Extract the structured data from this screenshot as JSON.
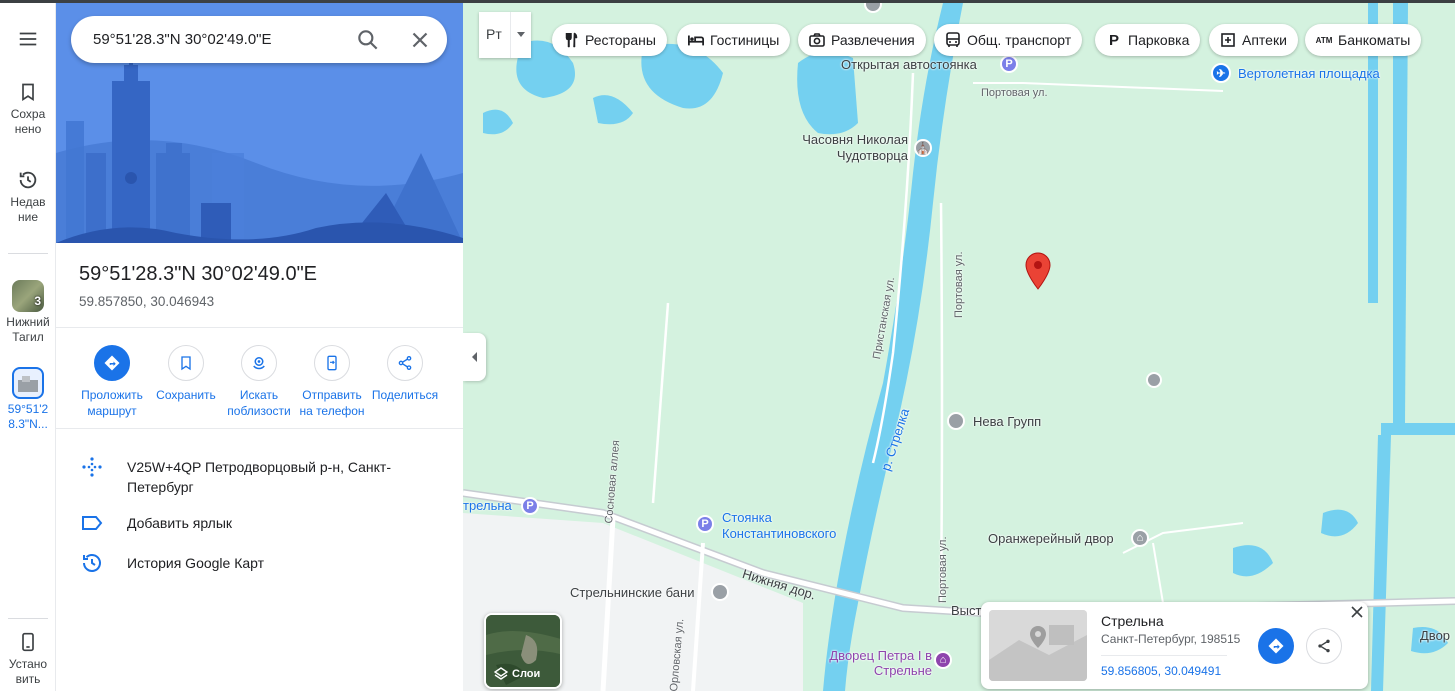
{
  "rail": {
    "menu_icon": "menu-icon",
    "saved_label": "Сохранено",
    "recent_label": "Недавние",
    "recent1": {
      "badge": "3",
      "label": "Нижний Тагил"
    },
    "recent2": {
      "label": "59°51'28.3\"N..."
    },
    "install_label": "Установить"
  },
  "search": {
    "value": "59°51'28.3\"N 30°02'49.0\"E"
  },
  "place": {
    "title": "59°51'28.3\"N 30°02'49.0\"E",
    "coords": "59.857850, 30.046943"
  },
  "actions": [
    {
      "label": "Проложить маршрут",
      "icon": "directions-icon"
    },
    {
      "label": "Сохранить",
      "icon": "bookmark-icon"
    },
    {
      "label": "Искать поблизости",
      "icon": "nearby-icon"
    },
    {
      "label": "Отправить на телефон",
      "icon": "send-to-phone-icon"
    },
    {
      "label": "Поделиться",
      "icon": "share-icon"
    }
  ],
  "info": {
    "plus_code": "V25W+4QP Петродворцовый р-н, Санкт-Петербург",
    "add_label": "Добавить ярлык",
    "history": "История Google Карт"
  },
  "transit_btn": "Рт",
  "chips": [
    {
      "label": "Рестораны",
      "icon": "fork-knife-icon"
    },
    {
      "label": "Гостиницы",
      "icon": "bed-icon"
    },
    {
      "label": "Развлечения",
      "icon": "camera-icon"
    },
    {
      "label": "Общ. транспорт",
      "icon": "bus-icon"
    },
    {
      "label": "Парковка",
      "icon": "parking-icon"
    },
    {
      "label": "Аптеки",
      "icon": "pharmacy-icon"
    },
    {
      "label": "Банкоматы",
      "icon": "atm-icon"
    }
  ],
  "map_labels": {
    "open_parking": "Открытая автостоянка",
    "helipad": "Вертолетная площадка",
    "portovaya_top": "Портовая ул.",
    "chapel": "Часовня Николая Чудотворца",
    "pristanskaya": "Пристанская ул.",
    "portovaya_mid": "Портовая ул.",
    "river": "р. Стрелка",
    "neva": "Нева Групп",
    "strelna_parking": "трельна",
    "konst_parking": "Стоянка Константиновского",
    "sosnovaya": "Сосновая аллея",
    "orangery": "Оранжерейный двор",
    "portovaya_low": "Портовая ул.",
    "nizhnyaya": "Нижняя дор.",
    "bani": "Стрельнинские бани",
    "orlovskaya": "Орловская ул.",
    "palace": "Дворец Петра I в Стрельне",
    "vyst": "Выст",
    "dvor": "Двор"
  },
  "layers_label": "Слои",
  "card": {
    "title": "Стрельна",
    "subtitle": "Санкт-Петербург, 198515",
    "coords": "59.856805, 30.049491"
  },
  "colors": {
    "accent": "#1a73e8",
    "pin": "#ea4335",
    "park": "#d4f2df",
    "water": "#74d0f0"
  }
}
